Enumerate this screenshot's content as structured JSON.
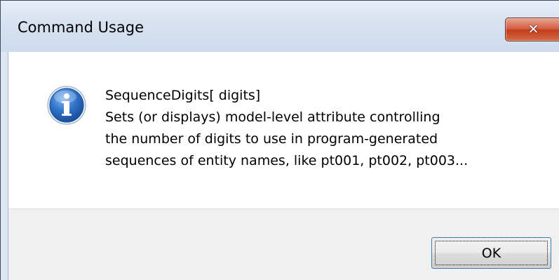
{
  "window": {
    "title": "Command Usage",
    "close_glyph": "✕"
  },
  "message": {
    "icon": "info-icon",
    "lines": [
      "SequenceDigits[ digits]",
      "Sets (or displays) model-level attribute controlling",
      "the number of digits to use in program-generated",
      "sequences of entity names, like pt001, pt002, pt003..."
    ]
  },
  "buttons": {
    "ok_label": "OK"
  },
  "colors": {
    "titlebar": "#d6e2f0",
    "close_button": "#c33b1c",
    "footer": "#f0f0f0",
    "info_icon": "#1f5fb4",
    "focus_border": "#3c7fb1"
  }
}
